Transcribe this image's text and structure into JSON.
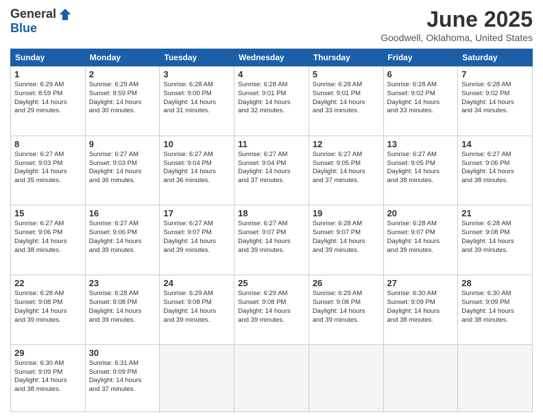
{
  "header": {
    "logo_general": "General",
    "logo_blue": "Blue",
    "month_title": "June 2025",
    "location": "Goodwell, Oklahoma, United States"
  },
  "days_of_week": [
    "Sunday",
    "Monday",
    "Tuesday",
    "Wednesday",
    "Thursday",
    "Friday",
    "Saturday"
  ],
  "weeks": [
    [
      {
        "day": "1",
        "sunrise": "6:29 AM",
        "sunset": "8:59 PM",
        "daylight": "14 hours and 29 minutes."
      },
      {
        "day": "2",
        "sunrise": "6:29 AM",
        "sunset": "8:59 PM",
        "daylight": "14 hours and 30 minutes."
      },
      {
        "day": "3",
        "sunrise": "6:28 AM",
        "sunset": "9:00 PM",
        "daylight": "14 hours and 31 minutes."
      },
      {
        "day": "4",
        "sunrise": "6:28 AM",
        "sunset": "9:01 PM",
        "daylight": "14 hours and 32 minutes."
      },
      {
        "day": "5",
        "sunrise": "6:28 AM",
        "sunset": "9:01 PM",
        "daylight": "14 hours and 33 minutes."
      },
      {
        "day": "6",
        "sunrise": "6:28 AM",
        "sunset": "9:02 PM",
        "daylight": "14 hours and 33 minutes."
      },
      {
        "day": "7",
        "sunrise": "6:28 AM",
        "sunset": "9:02 PM",
        "daylight": "14 hours and 34 minutes."
      }
    ],
    [
      {
        "day": "8",
        "sunrise": "6:27 AM",
        "sunset": "9:03 PM",
        "daylight": "14 hours and 35 minutes."
      },
      {
        "day": "9",
        "sunrise": "6:27 AM",
        "sunset": "9:03 PM",
        "daylight": "14 hours and 36 minutes."
      },
      {
        "day": "10",
        "sunrise": "6:27 AM",
        "sunset": "9:04 PM",
        "daylight": "14 hours and 36 minutes."
      },
      {
        "day": "11",
        "sunrise": "6:27 AM",
        "sunset": "9:04 PM",
        "daylight": "14 hours and 37 minutes."
      },
      {
        "day": "12",
        "sunrise": "6:27 AM",
        "sunset": "9:05 PM",
        "daylight": "14 hours and 37 minutes."
      },
      {
        "day": "13",
        "sunrise": "6:27 AM",
        "sunset": "9:05 PM",
        "daylight": "14 hours and 38 minutes."
      },
      {
        "day": "14",
        "sunrise": "6:27 AM",
        "sunset": "9:06 PM",
        "daylight": "14 hours and 38 minutes."
      }
    ],
    [
      {
        "day": "15",
        "sunrise": "6:27 AM",
        "sunset": "9:06 PM",
        "daylight": "14 hours and 38 minutes."
      },
      {
        "day": "16",
        "sunrise": "6:27 AM",
        "sunset": "9:06 PM",
        "daylight": "14 hours and 39 minutes."
      },
      {
        "day": "17",
        "sunrise": "6:27 AM",
        "sunset": "9:07 PM",
        "daylight": "14 hours and 39 minutes."
      },
      {
        "day": "18",
        "sunrise": "6:27 AM",
        "sunset": "9:07 PM",
        "daylight": "14 hours and 39 minutes."
      },
      {
        "day": "19",
        "sunrise": "6:28 AM",
        "sunset": "9:07 PM",
        "daylight": "14 hours and 39 minutes."
      },
      {
        "day": "20",
        "sunrise": "6:28 AM",
        "sunset": "9:07 PM",
        "daylight": "14 hours and 39 minutes."
      },
      {
        "day": "21",
        "sunrise": "6:28 AM",
        "sunset": "9:08 PM",
        "daylight": "14 hours and 39 minutes."
      }
    ],
    [
      {
        "day": "22",
        "sunrise": "6:28 AM",
        "sunset": "9:08 PM",
        "daylight": "14 hours and 39 minutes."
      },
      {
        "day": "23",
        "sunrise": "6:28 AM",
        "sunset": "9:08 PM",
        "daylight": "14 hours and 39 minutes."
      },
      {
        "day": "24",
        "sunrise": "6:29 AM",
        "sunset": "9:08 PM",
        "daylight": "14 hours and 39 minutes."
      },
      {
        "day": "25",
        "sunrise": "6:29 AM",
        "sunset": "9:08 PM",
        "daylight": "14 hours and 39 minutes."
      },
      {
        "day": "26",
        "sunrise": "6:29 AM",
        "sunset": "9:08 PM",
        "daylight": "14 hours and 39 minutes."
      },
      {
        "day": "27",
        "sunrise": "6:30 AM",
        "sunset": "9:09 PM",
        "daylight": "14 hours and 38 minutes."
      },
      {
        "day": "28",
        "sunrise": "6:30 AM",
        "sunset": "9:09 PM",
        "daylight": "14 hours and 38 minutes."
      }
    ],
    [
      {
        "day": "29",
        "sunrise": "6:30 AM",
        "sunset": "9:09 PM",
        "daylight": "14 hours and 38 minutes."
      },
      {
        "day": "30",
        "sunrise": "6:31 AM",
        "sunset": "9:09 PM",
        "daylight": "14 hours and 37 minutes."
      },
      null,
      null,
      null,
      null,
      null
    ]
  ]
}
